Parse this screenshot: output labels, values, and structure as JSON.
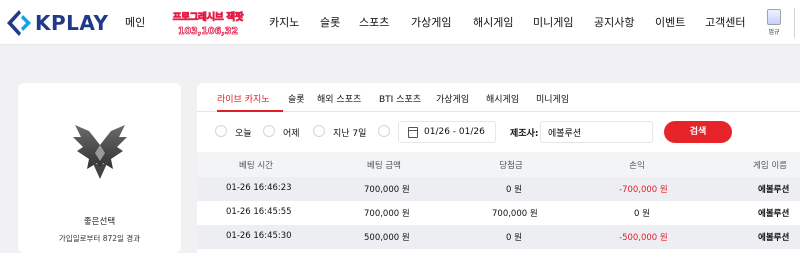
{
  "brand": {
    "logo_text": "KPLAY"
  },
  "nav": {
    "items": [
      {
        "key": "main",
        "label": "메인"
      },
      {
        "key": "casino",
        "label": "카지노"
      },
      {
        "key": "slot",
        "label": "슬롯"
      },
      {
        "key": "sports",
        "label": "스포츠"
      },
      {
        "key": "virtual",
        "label": "가상게임"
      },
      {
        "key": "hash",
        "label": "해시게임"
      },
      {
        "key": "mini",
        "label": "미니게임"
      },
      {
        "key": "notice",
        "label": "공지사항"
      },
      {
        "key": "event",
        "label": "이벤트"
      },
      {
        "key": "support",
        "label": "고객센터"
      }
    ],
    "promo": {
      "line1": "프로그레시브 잭팟",
      "line2": "103,106,32"
    },
    "guide_label": "멉규"
  },
  "profile": {
    "nickname": "좋은선택",
    "since": "가입일로부터 872일 경과"
  },
  "tabs": [
    {
      "label": "라이브 카지노",
      "active": true
    },
    {
      "label": "슬롯",
      "active": false
    },
    {
      "label": "해외 스포츠",
      "active": false
    },
    {
      "label": "BTI 스포츠",
      "active": false
    },
    {
      "label": "가상게임",
      "active": false
    },
    {
      "label": "해시게임",
      "active": false
    },
    {
      "label": "미니게임",
      "active": false
    }
  ],
  "filter": {
    "today": "오늘",
    "yesterday": "어제",
    "last7": "지난 7일",
    "date_range": "01/26 - 01/26",
    "maker_label": "제조사:",
    "maker_value": "에볼루션",
    "search_label": "검색"
  },
  "table": {
    "headers": [
      "베팅 시간",
      "베팅 금액",
      "당첨금",
      "손익",
      "게임 이름"
    ],
    "rows": [
      {
        "time": "01-26 16:46:23",
        "bet": "700,000 원",
        "win": "0 원",
        "pl": "-700,000 원",
        "pl_negative": true,
        "game": "에볼루션"
      },
      {
        "time": "01-26 16:45:55",
        "bet": "700,000 원",
        "win": "700,000 원",
        "pl": "0 원",
        "pl_negative": false,
        "game": "에볼루션"
      },
      {
        "time": "01-26 16:45:30",
        "bet": "500,000 원",
        "win": "0 원",
        "pl": "-500,000 원",
        "pl_negative": true,
        "game": "에볼루션"
      }
    ]
  },
  "colors": {
    "accent": "#e8242b",
    "brand": "#1f3a8a",
    "negative": "#e11d2a"
  }
}
